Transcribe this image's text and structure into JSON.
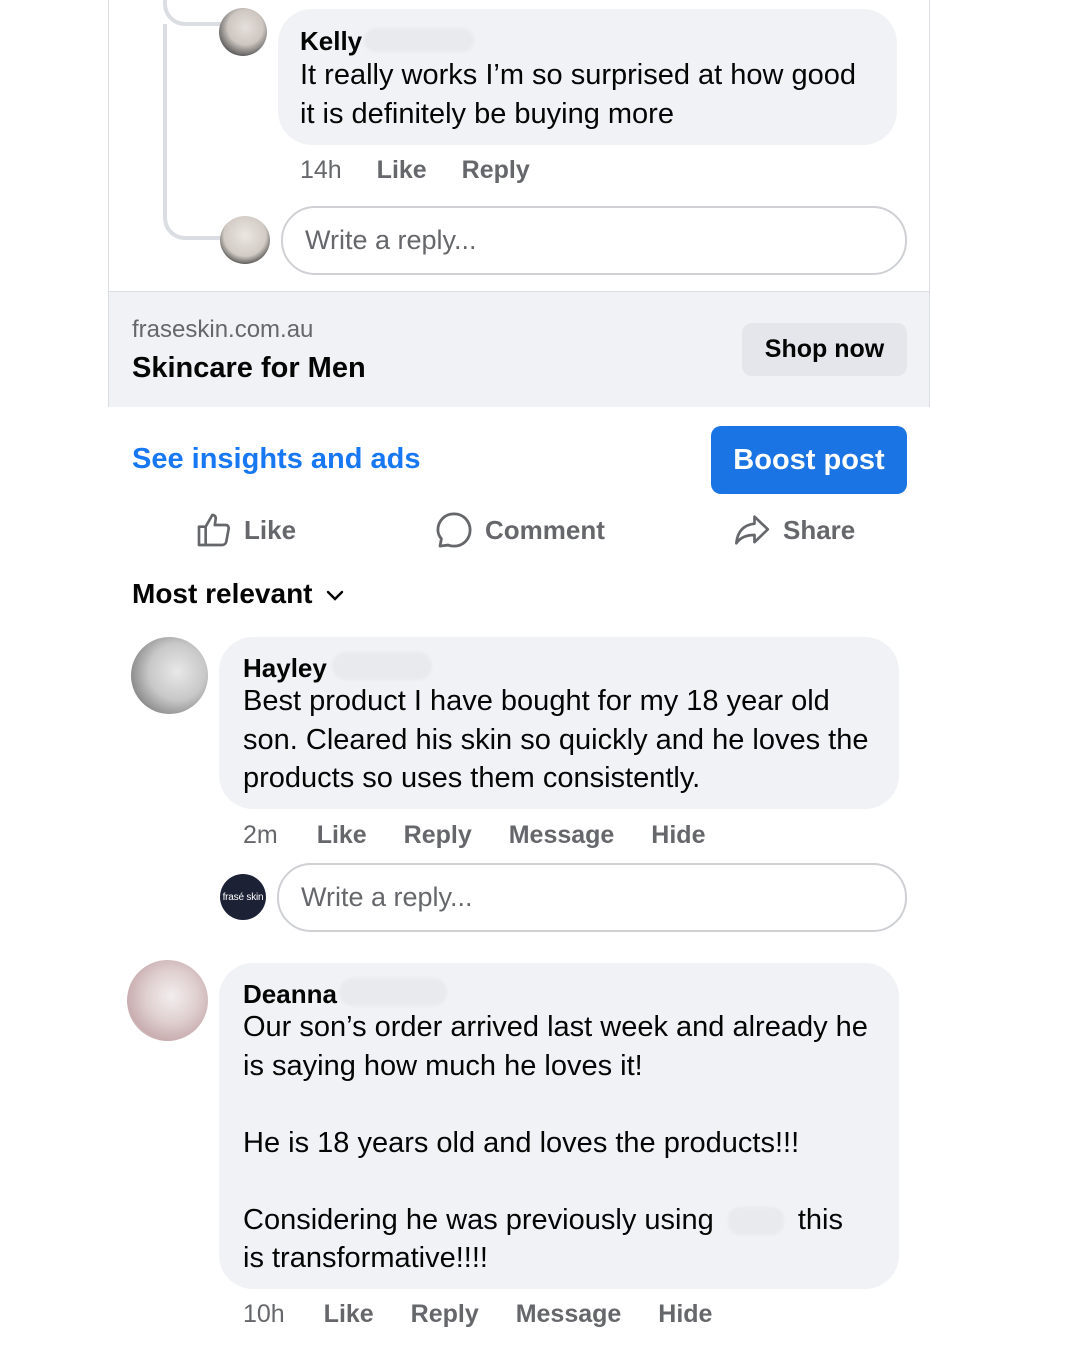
{
  "thread": {
    "kelly": {
      "name": "Kelly",
      "lines": [
        "It really works I’m so surprised at how good",
        "it is definitely be buying more"
      ],
      "time": "14h",
      "like": "Like",
      "reply": "Reply"
    },
    "reply_placeholder": "Write a reply..."
  },
  "link": {
    "domain": "fraseskin.com.au",
    "headline": "Skincare for Men",
    "cta": "Shop now"
  },
  "post_actions": {
    "insights": "See insights and ads",
    "boost": "Boost post",
    "like": "Like",
    "comment": "Comment",
    "share": "Share"
  },
  "sort": {
    "label": "Most relevant"
  },
  "comments": [
    {
      "name": "Hayley",
      "lines": [
        "Best product I have bought for my 18 year old",
        "son. Cleared his skin so quickly and he loves the",
        "products so uses them consistently."
      ],
      "time": "2m",
      "like": "Like",
      "reply": "Reply",
      "message": "Message",
      "hide": "Hide",
      "reply_placeholder": "Write a reply...",
      "page_avatar_text": "frasé skin"
    },
    {
      "name": "Deanna",
      "lines": [
        "Our son’s order arrived last week and already he",
        "is saying how much he loves it!",
        "He is 18 years old and loves the products!!!",
        "Considering he was previously using",
        "this",
        "is transformative!!!!"
      ],
      "time": "10h",
      "like": "Like",
      "reply": "Reply",
      "message": "Message",
      "hide": "Hide"
    }
  ],
  "colors": {
    "accent": "#1877f2",
    "boost_bg": "#1b74e4",
    "bubble_bg": "#f0f2f5",
    "meta_text": "#65676b"
  }
}
